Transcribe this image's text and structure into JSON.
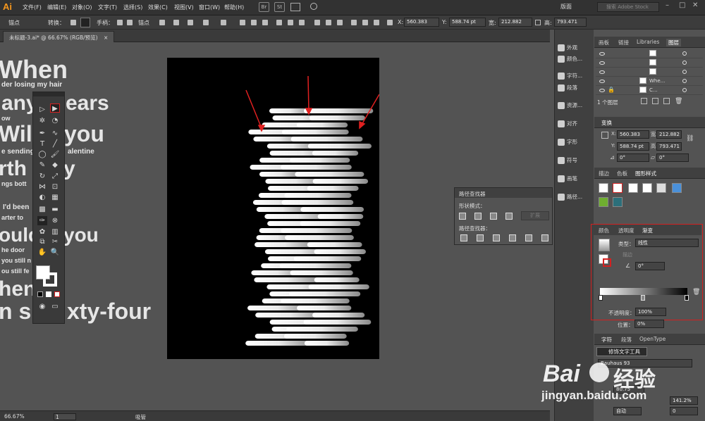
{
  "app": {
    "logo": "Ai",
    "menus": [
      "文件(F)",
      "编辑(E)",
      "对象(O)",
      "文字(T)",
      "选择(S)",
      "效果(C)",
      "视图(V)",
      "窗口(W)",
      "帮助(H)"
    ],
    "bridge": [
      "Br",
      "St"
    ],
    "workspace": "版面",
    "search_placeholder": "搜索 Adobe Stock"
  },
  "control": {
    "anchor": "锚点",
    "convert": "转换：",
    "handle": "手柄：",
    "anchor2": "锚点",
    "x_label": "X:",
    "x": "560.383",
    "y_label": "Y:",
    "y": "588.74 pt",
    "w_label": "宽:",
    "w": "212.882",
    "h_label": "高:",
    "h": "793.471"
  },
  "document": {
    "tab": "未标题-3.ai* @ 66.67% (RGB/预览)",
    "close": "×"
  },
  "canvas_text": {
    "l1": "When",
    "l2": "der losing my hair",
    "l3": "any",
    "l3b": "ears",
    "l4": "ow",
    "l5": "Will",
    "l5b": "you",
    "l6": "e sending",
    "l6b": "alentine",
    "l7": "rth",
    "l7b": "y",
    "l8": "ngs bott",
    "l9": "I'd been",
    "l10": "arter to",
    "l11": "ould",
    "l11b": "you",
    "l12": "he door",
    "l13": "you still n",
    "l14": "ou still fe",
    "l15": "hen",
    "l16": "n s",
    "l16b": "xty-four"
  },
  "status": {
    "zoom": "66.67%",
    "page": "1",
    "tool": "吸管"
  },
  "pathfinder": {
    "title": "路径查找器",
    "shape_modes": "形状模式：",
    "expand": "扩展",
    "finders": "路径查找器："
  },
  "iconcol": [
    "外观",
    "颜色...",
    "字符...",
    "段落",
    "资源...",
    "对齐",
    "字形",
    "符号",
    "画笔",
    "路径..."
  ],
  "layers": {
    "tabs": [
      "画板",
      "链接",
      "Libraries",
      "图层"
    ],
    "rows": [
      "Whe...",
      "C..."
    ],
    "count": "1 个图层"
  },
  "transform": {
    "title": "变换",
    "x": "560.383",
    "y": "588.74 pt",
    "w": "212.882",
    "h": "793.471",
    "ang1": "0°",
    "ang2": "0°"
  },
  "swatch_tabs": [
    "描边",
    "色板",
    "图形样式"
  ],
  "gradient": {
    "tabs": [
      "颜色",
      "透明度",
      "渐变"
    ],
    "type_label": "类型：",
    "type_value": "线性",
    "stroke_label": "描边",
    "angle": "0°",
    "opacity_label": "不透明度：",
    "opacity": "100%",
    "location_label": "位置：",
    "location": "0%"
  },
  "character": {
    "tabs": [
      "字符",
      "段落",
      "OpenType"
    ],
    "tooltip": "修饰文字工具",
    "font": "Bauhaus 93",
    "size": "80.75",
    "leading": "141.2%",
    "auto": "自动",
    "zero": "0"
  },
  "watermark": {
    "brand": "Bai",
    "brand2": "经验",
    "url": "jingyan.baidu.com"
  },
  "colors": {
    "accent": "#d42020",
    "artboard": "#000000",
    "panel": "#535353",
    "chrome": "#323232"
  }
}
